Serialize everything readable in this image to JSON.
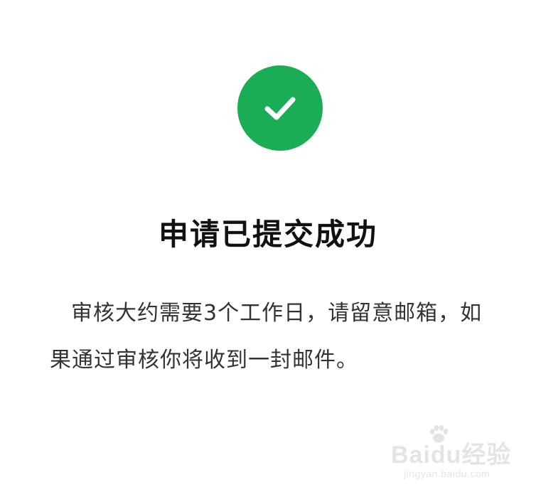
{
  "status": {
    "icon": "check-circle-icon",
    "color": "#1aad56",
    "title": "申请已提交成功",
    "description": "审核大约需要3个工作日，请留意邮箱，如果通过审核你将收到一封邮件。"
  },
  "watermark": {
    "logo_text": "Baidu经验",
    "url": "jingyan.baidu.com"
  }
}
